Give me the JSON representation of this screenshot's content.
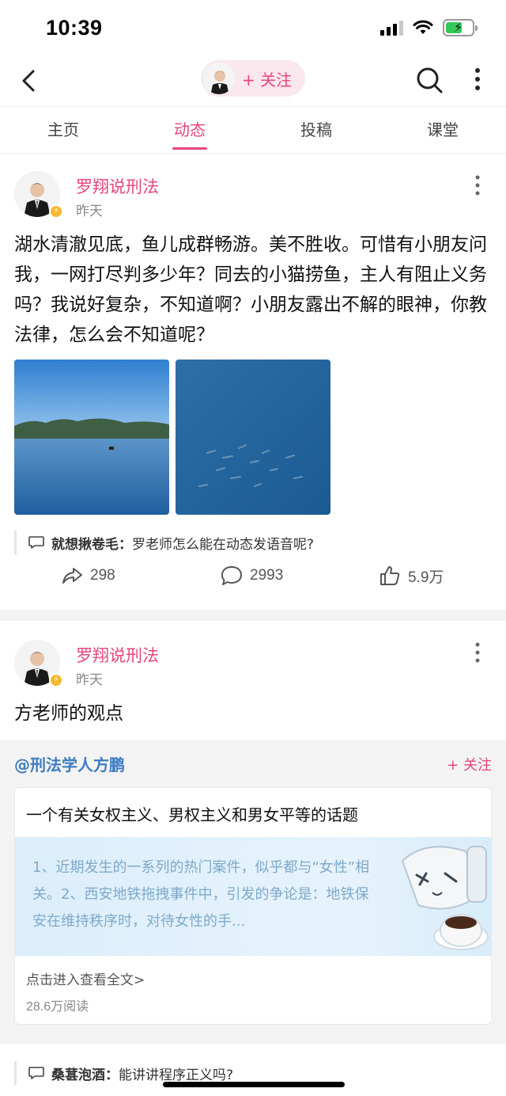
{
  "status": {
    "time": "10:39"
  },
  "nav": {
    "follow_label": "+ 关注"
  },
  "tabs": [
    {
      "label": "主页"
    },
    {
      "label": "动态"
    },
    {
      "label": "投稿"
    },
    {
      "label": "课堂"
    }
  ],
  "posts": [
    {
      "author": "罗翔说刑法",
      "time": "昨天",
      "text": "湖水清澈见底，鱼儿成群畅游。美不胜收。可惜有小朋友问我，一网打尽判多少年？同去的小猫捞鱼，主人有阻止义务吗？我说好复杂，不知道啊？小朋友露出不解的眼神，你教法律，怎么会不知道呢？",
      "comment": {
        "name": "就想揪卷毛：",
        "text": "罗老师怎么能在动态发语音呢?"
      },
      "actions": {
        "share": "298",
        "comment": "2993",
        "like": "5.9万"
      }
    },
    {
      "author": "罗翔说刑法",
      "time": "昨天",
      "text": "方老师的观点",
      "quote": {
        "user": "@刑法学人方鹏",
        "follow": "+ 关注",
        "article_title": "一个有关女权主义、男权主义和男女平等的话题",
        "excerpt": "1、近期发生的一系列的热门案件，似乎都与“女性”相关。2、西安地铁拖拽事件中，引发的争论是：地铁保安在维持秩序时，对待女性的手...",
        "read_more": "点击进入查看全文>",
        "reads": "28.6万阅读"
      },
      "comment": {
        "name": "桑葚泡酒：",
        "text": "能讲讲程序正义吗?"
      }
    }
  ],
  "colors": {
    "accent": "#e8457a",
    "link": "#3e7cc2",
    "divider": "#f3f3f3"
  }
}
